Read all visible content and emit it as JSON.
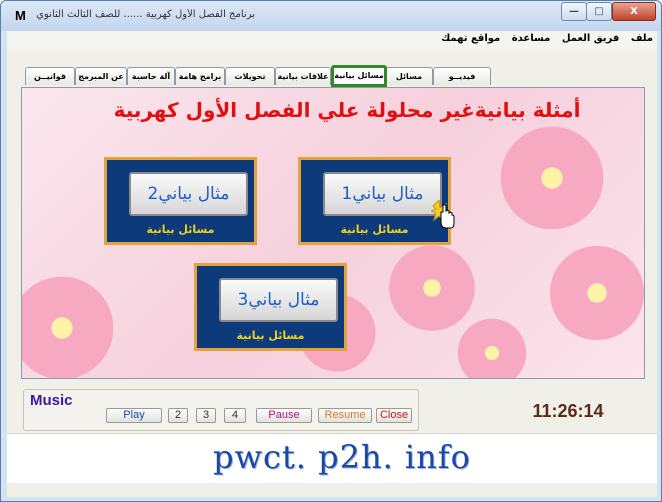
{
  "window": {
    "app_icon": "M",
    "title": "برنامج الفصل الأول كهربية ...... للصف الثالث الثانوي"
  },
  "title_buttons": {
    "minimize": "—",
    "maximize": "□",
    "close": "X"
  },
  "menu": {
    "items": [
      "ملف",
      "فريق العمل",
      "مساعدة",
      "مواقع تهمك"
    ]
  },
  "tabs": {
    "items": [
      "فيديــو",
      "مسائل",
      "مسائل بيانية",
      "علاقات بيانية",
      "تحويلات",
      "برامج هامة",
      "آلة حاسبة",
      "عن المبرمج",
      "قوانيــن"
    ],
    "active_index": 2
  },
  "pane": {
    "heading": "أمثلة بيانيةغير محلولة علي الفصل الأول كهربية",
    "cards": [
      {
        "button": "مثال بياني1",
        "caption": "مسائل بيانية"
      },
      {
        "button": "مثال بياني2",
        "caption": "مسائل بيانية"
      },
      {
        "button": "مثال بياني3",
        "caption": "مسائل بيانية"
      }
    ]
  },
  "player": {
    "label": "Music",
    "buttons": {
      "play": "Play",
      "track2": "2",
      "track3": "3",
      "track4": "4",
      "pause": "Pause",
      "resume": "Resume",
      "close": "Close"
    }
  },
  "clock": "11:26:14",
  "banner": "pwct. p2h. info",
  "colors": {
    "heading": "#e01010",
    "card_bg": "#0d3a7a",
    "card_border": "#e2a23c",
    "card_button_text": "#1b5fc7",
    "caption": "#f3d21b",
    "active_tab_highlight": "#2f8a2a",
    "music_label": "#3b1aa3",
    "banner_text": "#1a47a8"
  }
}
